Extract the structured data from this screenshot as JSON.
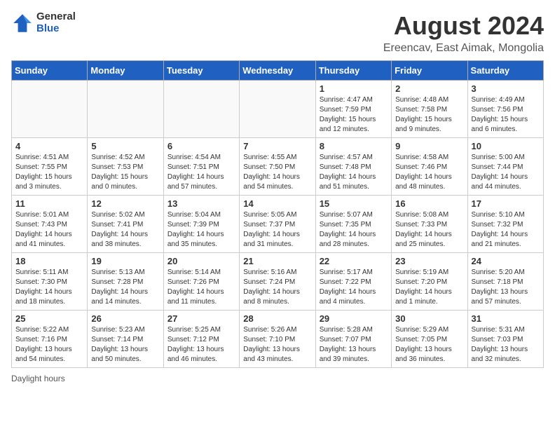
{
  "logo": {
    "general": "General",
    "blue": "Blue"
  },
  "title": "August 2024",
  "subtitle": "Ereencav, East Aimak, Mongolia",
  "days_of_week": [
    "Sunday",
    "Monday",
    "Tuesday",
    "Wednesday",
    "Thursday",
    "Friday",
    "Saturday"
  ],
  "legend": "Daylight hours",
  "weeks": [
    [
      {
        "day": "",
        "info": ""
      },
      {
        "day": "",
        "info": ""
      },
      {
        "day": "",
        "info": ""
      },
      {
        "day": "",
        "info": ""
      },
      {
        "day": "1",
        "info": "Sunrise: 4:47 AM\nSunset: 7:59 PM\nDaylight: 15 hours\nand 12 minutes."
      },
      {
        "day": "2",
        "info": "Sunrise: 4:48 AM\nSunset: 7:58 PM\nDaylight: 15 hours\nand 9 minutes."
      },
      {
        "day": "3",
        "info": "Sunrise: 4:49 AM\nSunset: 7:56 PM\nDaylight: 15 hours\nand 6 minutes."
      }
    ],
    [
      {
        "day": "4",
        "info": "Sunrise: 4:51 AM\nSunset: 7:55 PM\nDaylight: 15 hours\nand 3 minutes."
      },
      {
        "day": "5",
        "info": "Sunrise: 4:52 AM\nSunset: 7:53 PM\nDaylight: 15 hours\nand 0 minutes."
      },
      {
        "day": "6",
        "info": "Sunrise: 4:54 AM\nSunset: 7:51 PM\nDaylight: 14 hours\nand 57 minutes."
      },
      {
        "day": "7",
        "info": "Sunrise: 4:55 AM\nSunset: 7:50 PM\nDaylight: 14 hours\nand 54 minutes."
      },
      {
        "day": "8",
        "info": "Sunrise: 4:57 AM\nSunset: 7:48 PM\nDaylight: 14 hours\nand 51 minutes."
      },
      {
        "day": "9",
        "info": "Sunrise: 4:58 AM\nSunset: 7:46 PM\nDaylight: 14 hours\nand 48 minutes."
      },
      {
        "day": "10",
        "info": "Sunrise: 5:00 AM\nSunset: 7:44 PM\nDaylight: 14 hours\nand 44 minutes."
      }
    ],
    [
      {
        "day": "11",
        "info": "Sunrise: 5:01 AM\nSunset: 7:43 PM\nDaylight: 14 hours\nand 41 minutes."
      },
      {
        "day": "12",
        "info": "Sunrise: 5:02 AM\nSunset: 7:41 PM\nDaylight: 14 hours\nand 38 minutes."
      },
      {
        "day": "13",
        "info": "Sunrise: 5:04 AM\nSunset: 7:39 PM\nDaylight: 14 hours\nand 35 minutes."
      },
      {
        "day": "14",
        "info": "Sunrise: 5:05 AM\nSunset: 7:37 PM\nDaylight: 14 hours\nand 31 minutes."
      },
      {
        "day": "15",
        "info": "Sunrise: 5:07 AM\nSunset: 7:35 PM\nDaylight: 14 hours\nand 28 minutes."
      },
      {
        "day": "16",
        "info": "Sunrise: 5:08 AM\nSunset: 7:33 PM\nDaylight: 14 hours\nand 25 minutes."
      },
      {
        "day": "17",
        "info": "Sunrise: 5:10 AM\nSunset: 7:32 PM\nDaylight: 14 hours\nand 21 minutes."
      }
    ],
    [
      {
        "day": "18",
        "info": "Sunrise: 5:11 AM\nSunset: 7:30 PM\nDaylight: 14 hours\nand 18 minutes."
      },
      {
        "day": "19",
        "info": "Sunrise: 5:13 AM\nSunset: 7:28 PM\nDaylight: 14 hours\nand 14 minutes."
      },
      {
        "day": "20",
        "info": "Sunrise: 5:14 AM\nSunset: 7:26 PM\nDaylight: 14 hours\nand 11 minutes."
      },
      {
        "day": "21",
        "info": "Sunrise: 5:16 AM\nSunset: 7:24 PM\nDaylight: 14 hours\nand 8 minutes."
      },
      {
        "day": "22",
        "info": "Sunrise: 5:17 AM\nSunset: 7:22 PM\nDaylight: 14 hours\nand 4 minutes."
      },
      {
        "day": "23",
        "info": "Sunrise: 5:19 AM\nSunset: 7:20 PM\nDaylight: 14 hours\nand 1 minute."
      },
      {
        "day": "24",
        "info": "Sunrise: 5:20 AM\nSunset: 7:18 PM\nDaylight: 13 hours\nand 57 minutes."
      }
    ],
    [
      {
        "day": "25",
        "info": "Sunrise: 5:22 AM\nSunset: 7:16 PM\nDaylight: 13 hours\nand 54 minutes."
      },
      {
        "day": "26",
        "info": "Sunrise: 5:23 AM\nSunset: 7:14 PM\nDaylight: 13 hours\nand 50 minutes."
      },
      {
        "day": "27",
        "info": "Sunrise: 5:25 AM\nSunset: 7:12 PM\nDaylight: 13 hours\nand 46 minutes."
      },
      {
        "day": "28",
        "info": "Sunrise: 5:26 AM\nSunset: 7:10 PM\nDaylight: 13 hours\nand 43 minutes."
      },
      {
        "day": "29",
        "info": "Sunrise: 5:28 AM\nSunset: 7:07 PM\nDaylight: 13 hours\nand 39 minutes."
      },
      {
        "day": "30",
        "info": "Sunrise: 5:29 AM\nSunset: 7:05 PM\nDaylight: 13 hours\nand 36 minutes."
      },
      {
        "day": "31",
        "info": "Sunrise: 5:31 AM\nSunset: 7:03 PM\nDaylight: 13 hours\nand 32 minutes."
      }
    ]
  ]
}
